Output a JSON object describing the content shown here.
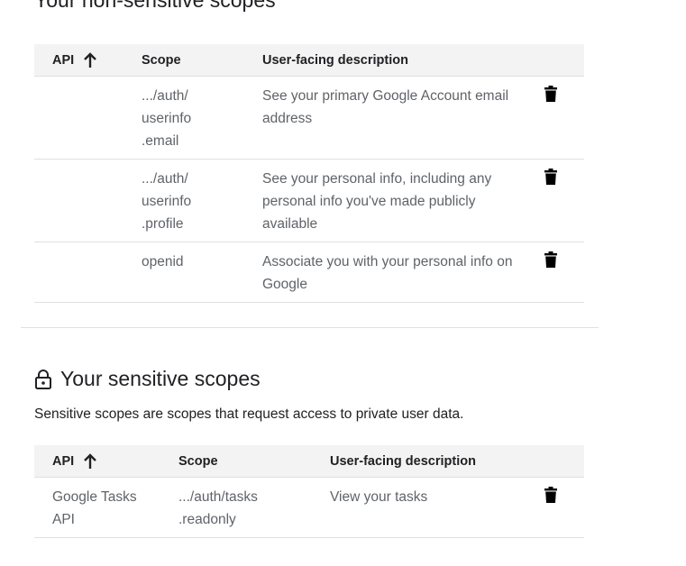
{
  "non_sensitive": {
    "title": "Your non-sensitive scopes",
    "columns": {
      "api": "API",
      "scope": "Scope",
      "description": "User-facing description"
    },
    "rows": [
      {
        "api": "",
        "scope": ".../auth/\nuserinfo\n.email",
        "description": "See your primary Google Account email address"
      },
      {
        "api": "",
        "scope": ".../auth/\nuserinfo\n.profile",
        "description": "See your personal info, including any personal info you've made publicly available"
      },
      {
        "api": "",
        "scope": "openid",
        "description": "Associate you with your personal info on Google"
      }
    ]
  },
  "sensitive": {
    "title": "Your sensitive scopes",
    "subtext": "Sensitive scopes are scopes that request access to private user data.",
    "columns": {
      "api": "API",
      "scope": "Scope",
      "description": "User-facing description"
    },
    "rows": [
      {
        "api": "Google Tasks\nAPI",
        "scope": ".../auth/tasks\n.readonly",
        "description": "View your tasks"
      }
    ]
  },
  "icons": {
    "sort": "arrow-up-icon",
    "delete": "trash-icon",
    "lock": "lock-icon"
  }
}
